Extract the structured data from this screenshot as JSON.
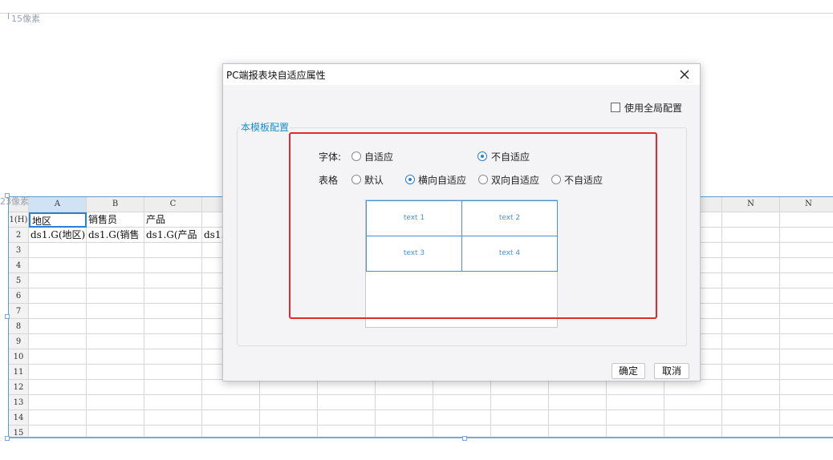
{
  "canvas": {
    "top_height_label": "15像素",
    "row_height_label": "23像素"
  },
  "sheet": {
    "columns": [
      "A",
      "B",
      "C",
      "",
      "",
      "",
      "",
      "",
      "",
      "",
      "",
      "",
      "N",
      "N"
    ],
    "row_labels": [
      "1(H)",
      "2",
      "3",
      "4",
      "5",
      "6",
      "7",
      "8",
      "9",
      "10",
      "11",
      "12",
      "13",
      "14",
      "15"
    ],
    "row1": [
      "地区",
      "销售员",
      "产品"
    ],
    "row2": [
      "ds1.G(地区)",
      "ds1.G(销售",
      "ds1.G(产品",
      "ds1."
    ]
  },
  "dialog": {
    "title": "PC端报表块自适应属性",
    "use_global_label": "使用全局配置",
    "use_global_checked": false,
    "group_title": "本模板配置",
    "font_label": "字体:",
    "font_options": [
      "自适应",
      "不自适应"
    ],
    "font_selected": "不自适应",
    "table_label": "表格",
    "table_options": [
      "默认",
      "横向自适应",
      "双向自适应",
      "不自适应"
    ],
    "table_selected": "横向自适应",
    "preview_cells": [
      "text 1",
      "text 2",
      "text 3",
      "text 4"
    ],
    "ok_label": "确定",
    "cancel_label": "取消"
  },
  "colors": {
    "accent": "#2a7fd4",
    "group_title": "#1a8fd3",
    "highlight_box": "#e02b2b",
    "preview_line": "#4a90d9"
  }
}
